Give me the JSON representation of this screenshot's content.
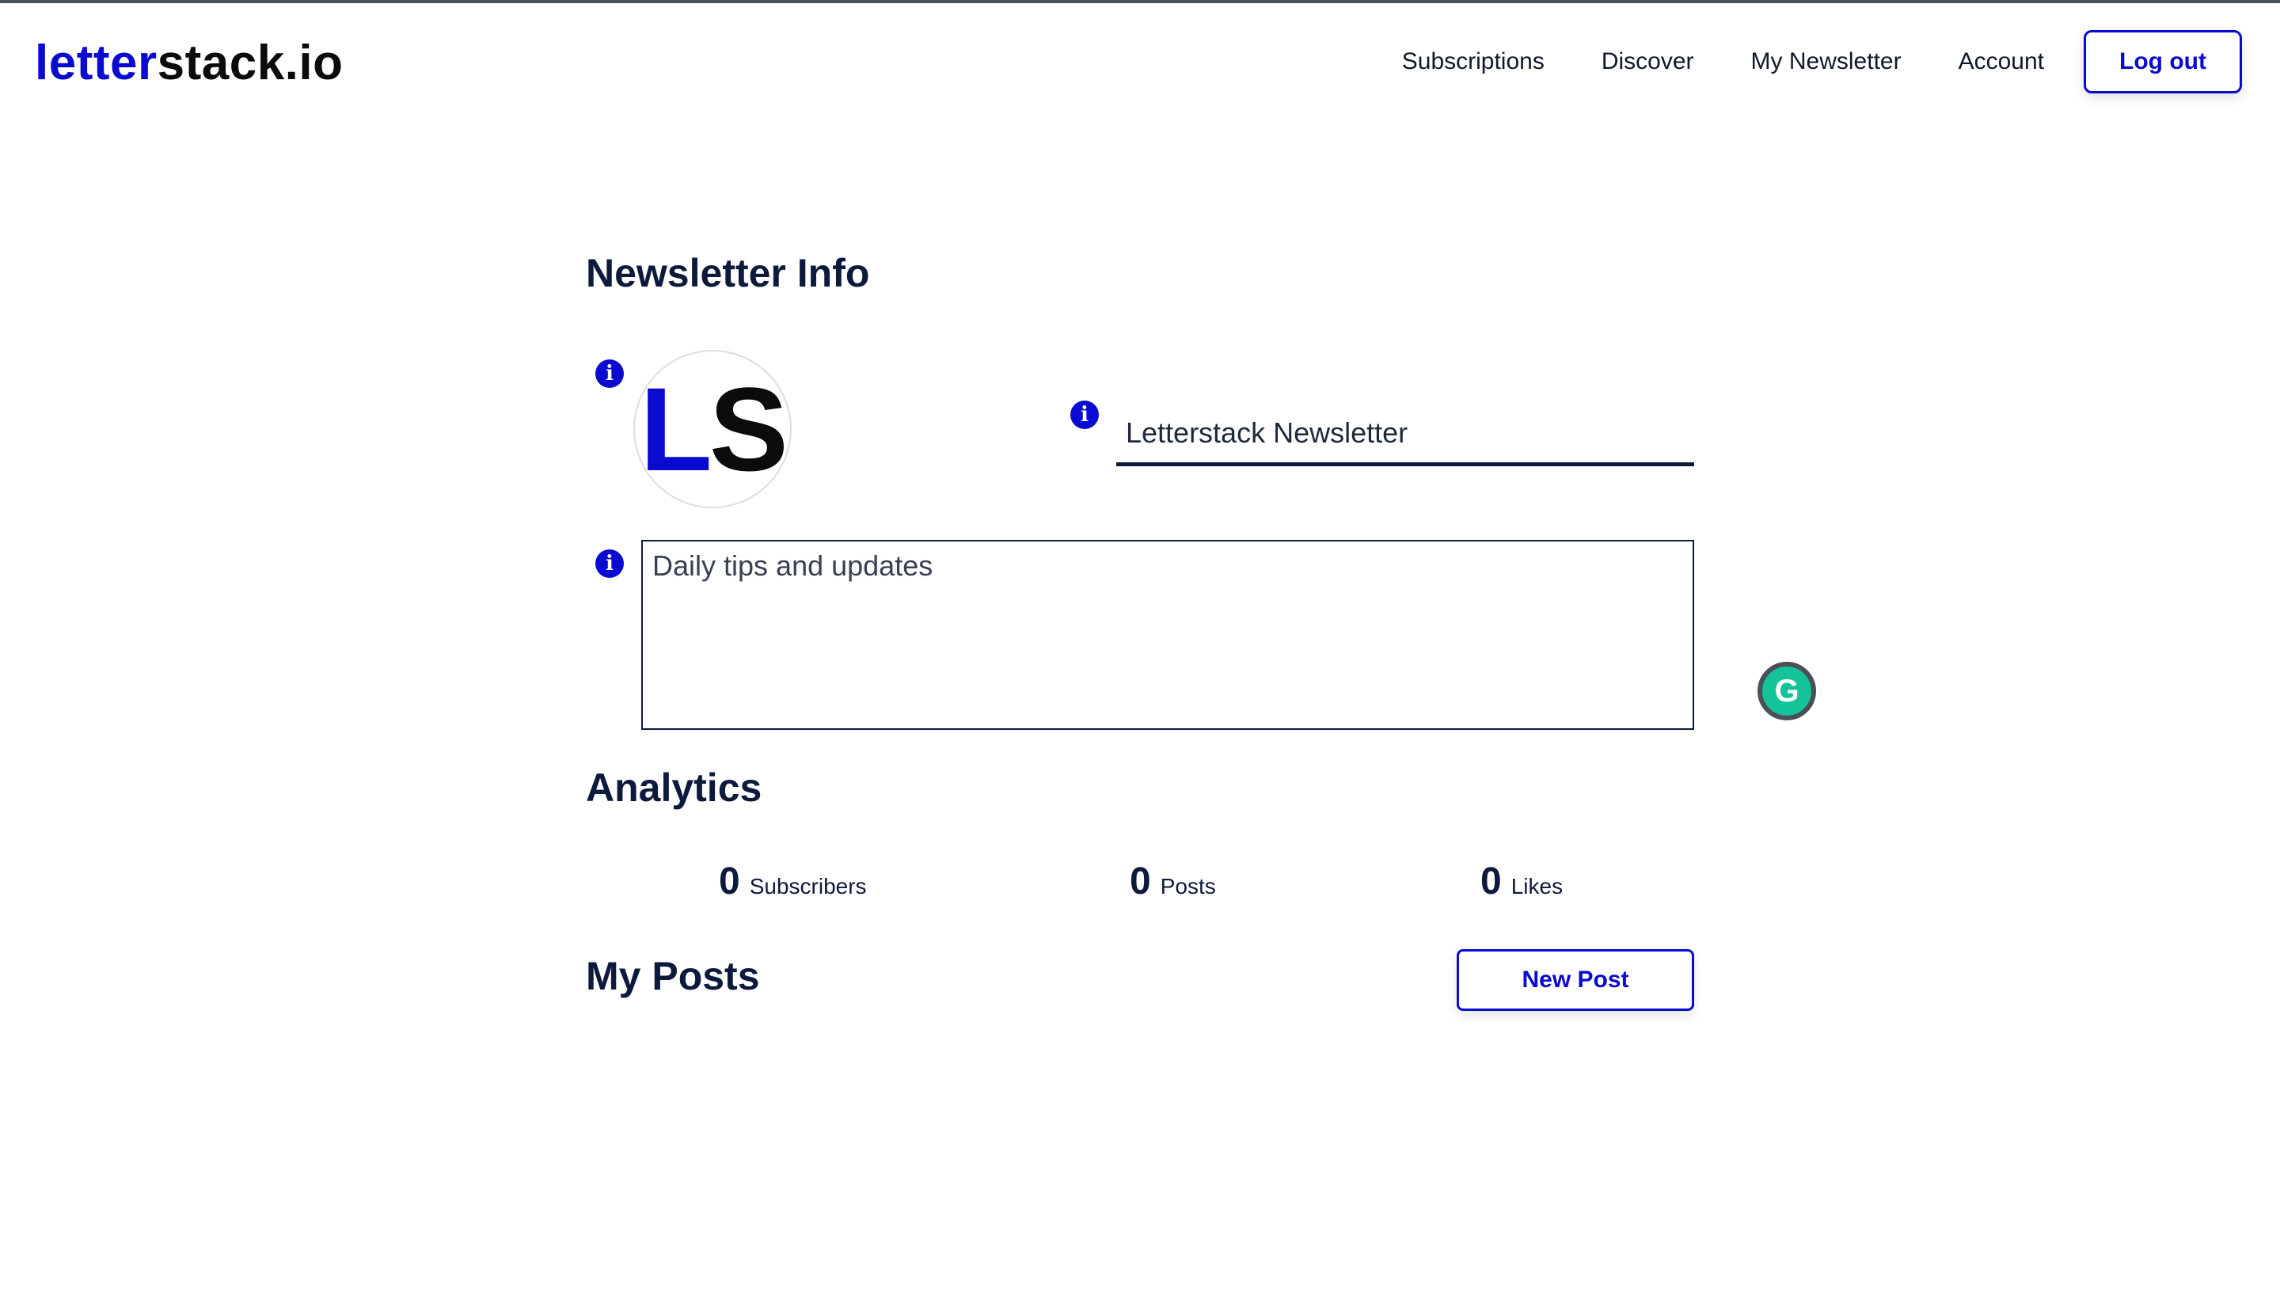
{
  "header": {
    "logo_part1": "letter",
    "logo_part2": "stack.io",
    "nav": [
      "Subscriptions",
      "Discover",
      "My Newsletter",
      "Account"
    ],
    "logout_label": "Log out"
  },
  "newsletter_info": {
    "title": "Newsletter Info",
    "avatar_l": "L",
    "avatar_s": "S",
    "name_value": "Letterstack Newsletter",
    "description_value": "Daily tips and updates"
  },
  "analytics": {
    "title": "Analytics",
    "stats": [
      {
        "value": "0",
        "label": "Subscribers"
      },
      {
        "value": "0",
        "label": "Posts"
      },
      {
        "value": "0",
        "label": "Likes"
      }
    ]
  },
  "posts": {
    "title": "My Posts",
    "new_post_label": "New Post"
  },
  "icons": {
    "info": "info-circle-icon",
    "grammarly": "grammarly-icon"
  },
  "colors": {
    "brand_blue": "#0a0ad0",
    "dark_navy": "#0e1a3c",
    "grammarly_green": "#15c39a"
  }
}
